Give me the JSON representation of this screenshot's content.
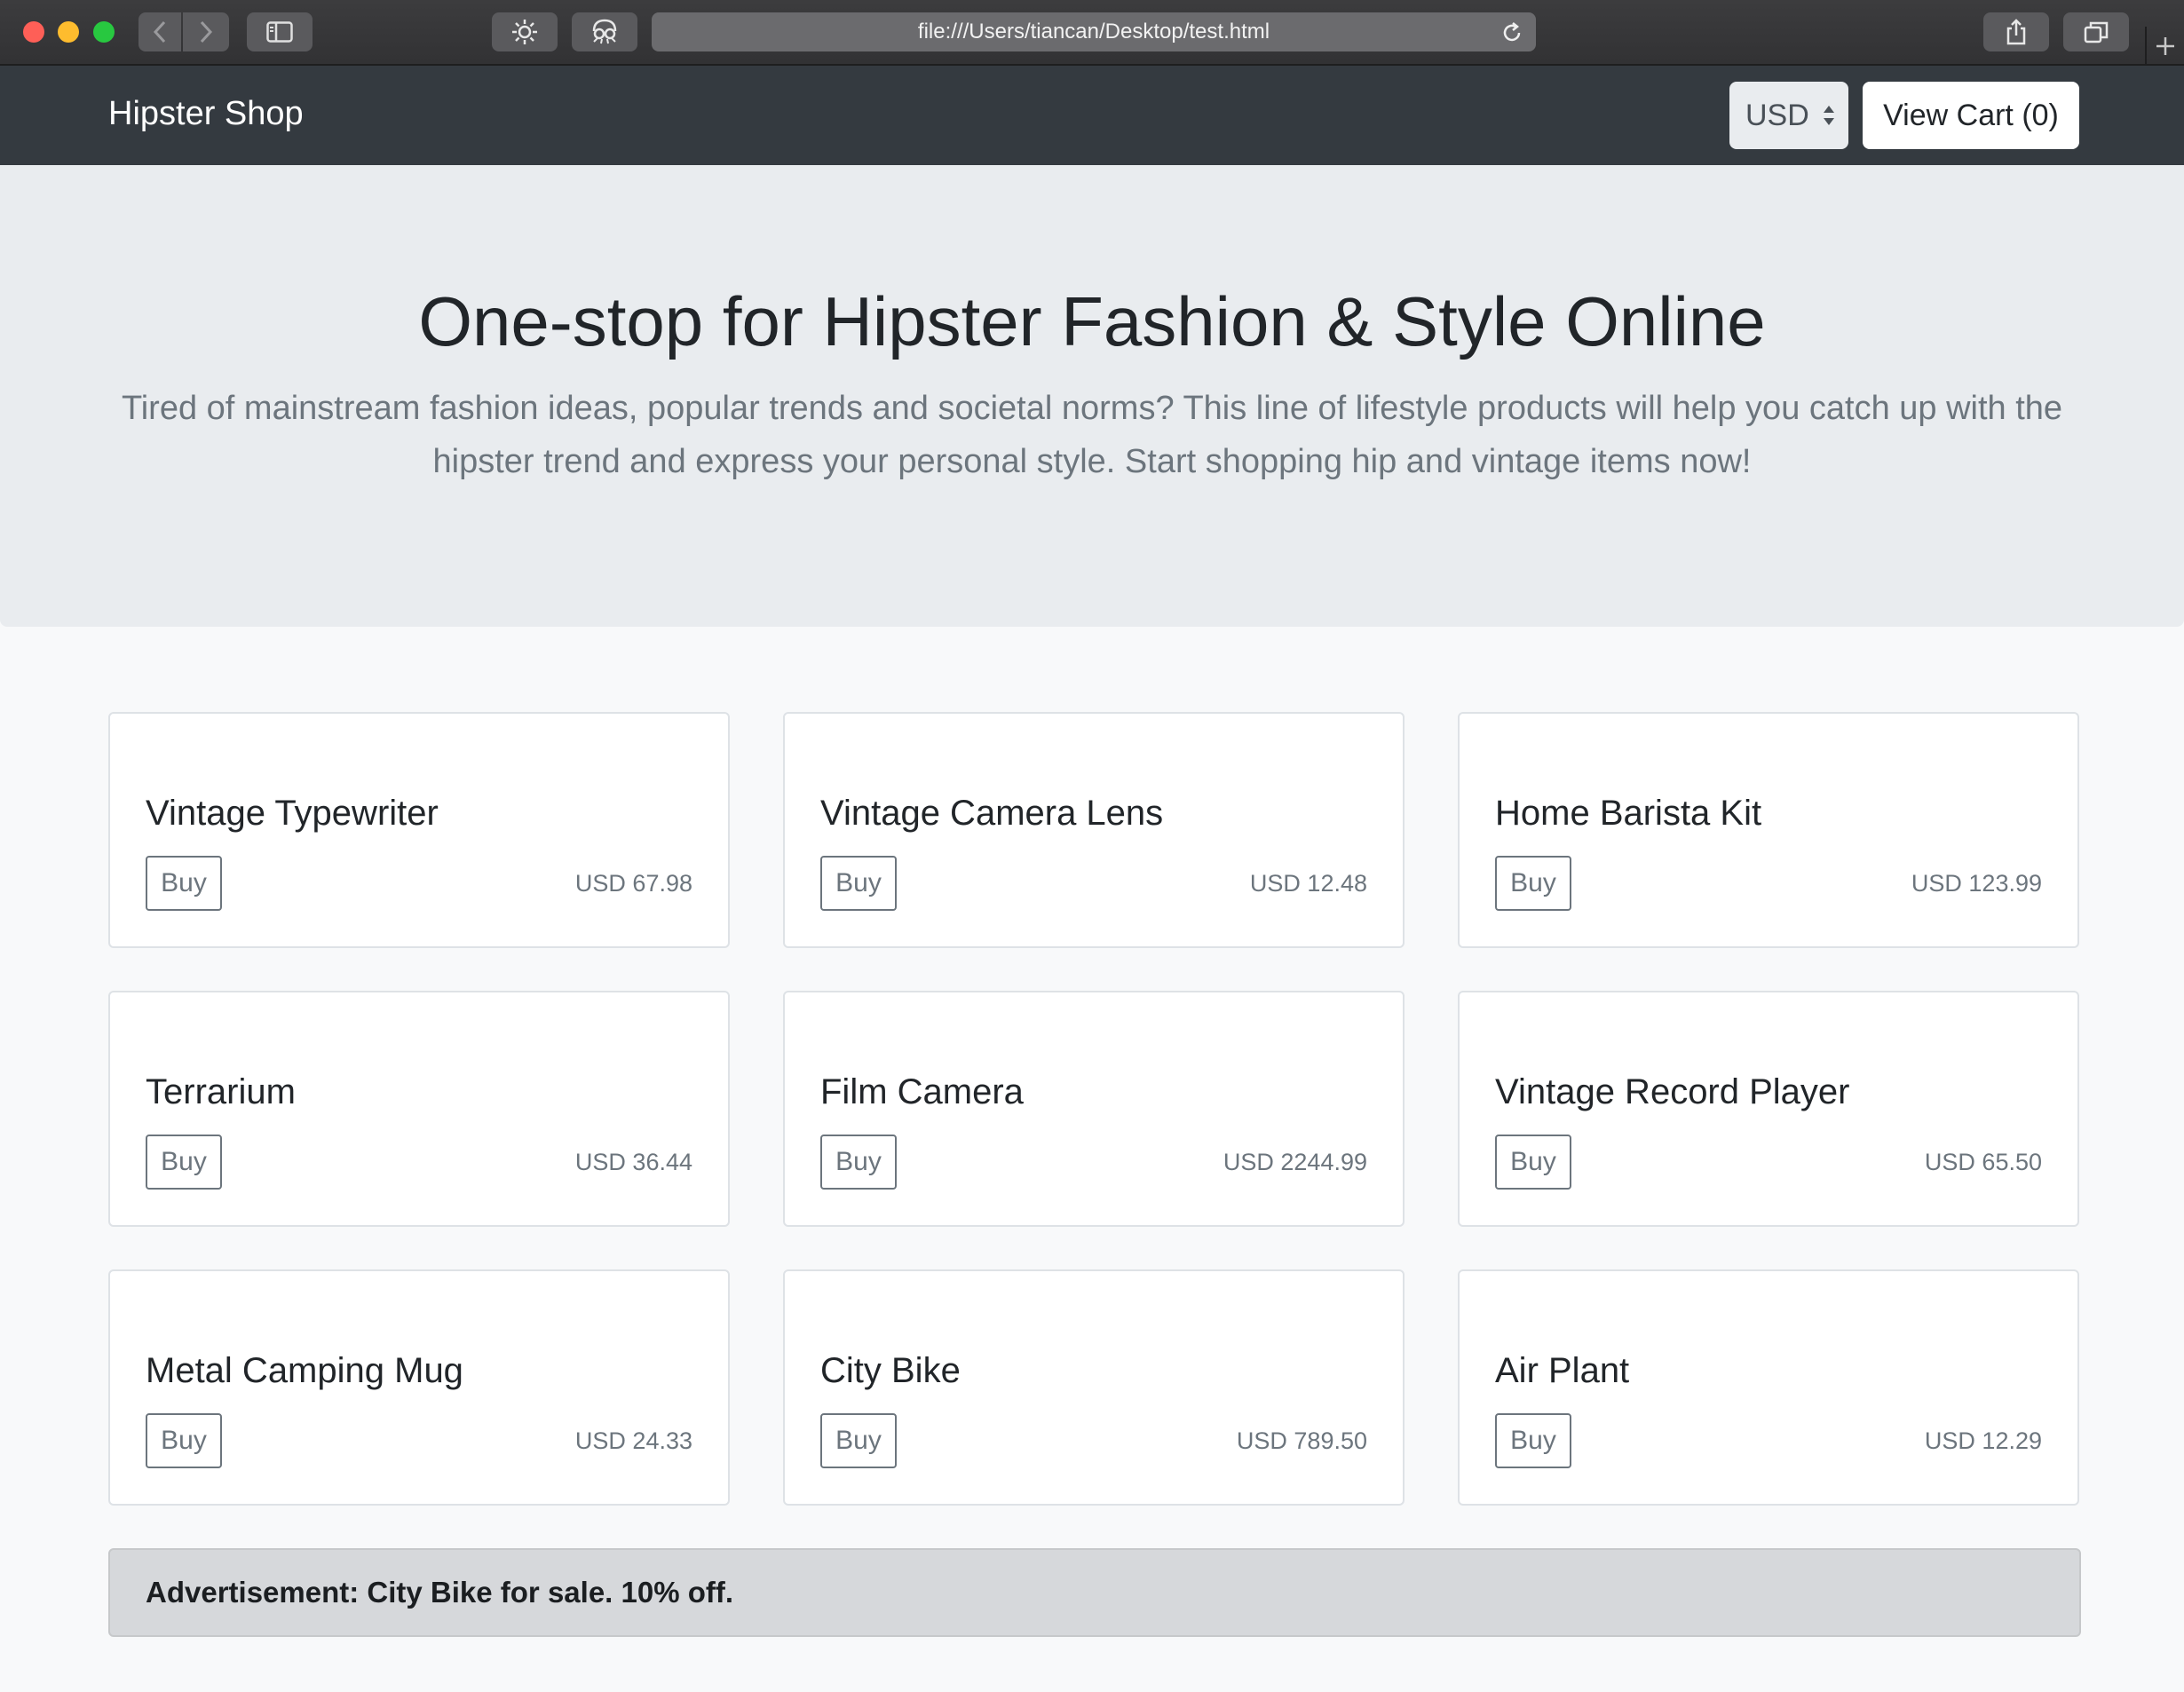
{
  "browser": {
    "url": "file:///Users/tiancan/Desktop/test.html"
  },
  "navbar": {
    "brand": "Hipster Shop",
    "currency": "USD",
    "view_cart": "View Cart (0)"
  },
  "hero": {
    "title": "One-stop for Hipster Fashion & Style Online",
    "description": "Tired of mainstream fashion ideas, popular trends and societal norms? This line of lifestyle products will help you catch up with the hipster trend and express your personal style. Start shopping hip and vintage items now!"
  },
  "products": [
    {
      "name": "Vintage Typewriter",
      "buy": "Buy",
      "price": "USD 67.98"
    },
    {
      "name": "Vintage Camera Lens",
      "buy": "Buy",
      "price": "USD 12.48"
    },
    {
      "name": "Home Barista Kit",
      "buy": "Buy",
      "price": "USD 123.99"
    },
    {
      "name": "Terrarium",
      "buy": "Buy",
      "price": "USD 36.44"
    },
    {
      "name": "Film Camera",
      "buy": "Buy",
      "price": "USD 2244.99"
    },
    {
      "name": "Vintage Record Player",
      "buy": "Buy",
      "price": "USD 65.50"
    },
    {
      "name": "Metal Camping Mug",
      "buy": "Buy",
      "price": "USD 24.33"
    },
    {
      "name": "City Bike",
      "buy": "Buy",
      "price": "USD 789.50"
    },
    {
      "name": "Air Plant",
      "buy": "Buy",
      "price": "USD 12.29"
    }
  ],
  "advertisement": {
    "text": "Advertisement: City Bike for sale. 10% off."
  },
  "colors": {
    "navbar": "#343a40",
    "jumbotron": "#e9ecef",
    "page_background": "#f8f9fa",
    "muted_text": "#6c757d",
    "ad_background": "#d6d8db"
  }
}
